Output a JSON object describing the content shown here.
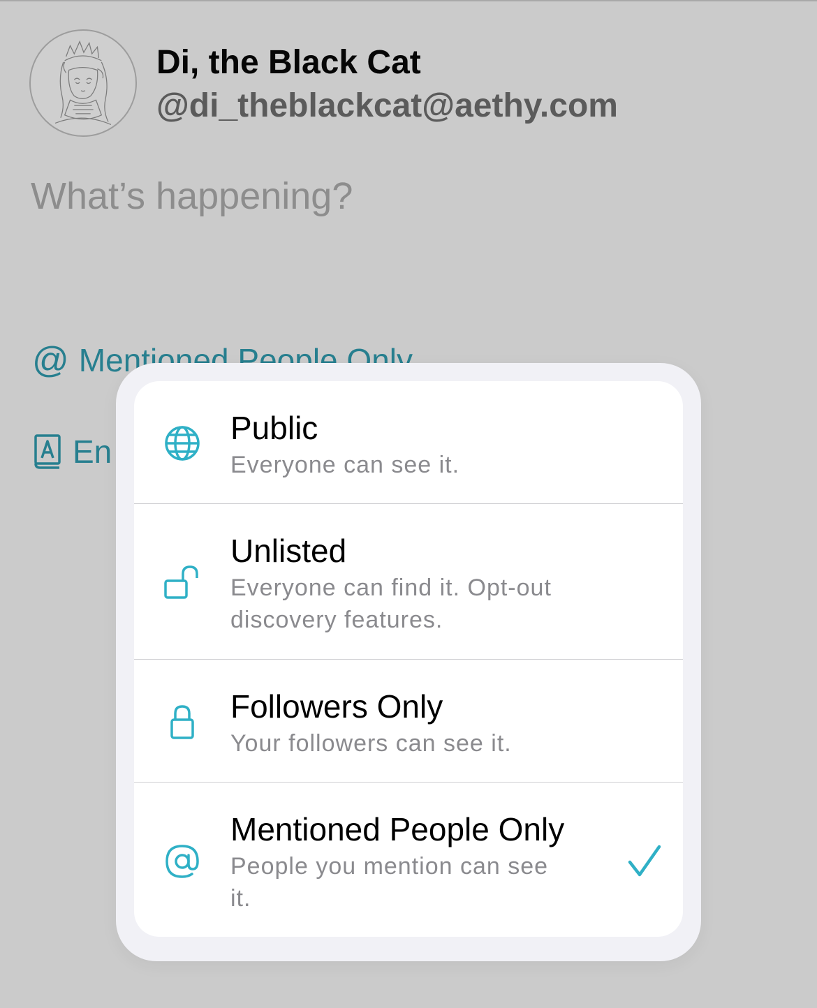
{
  "profile": {
    "display_name": "Di, the Black Cat",
    "handle": "@di_theblackcat@aethy.com"
  },
  "composer": {
    "placeholder": "What’s happening?"
  },
  "composer_options": {
    "visibility_label": "Mentioned People Only",
    "language_label": "En"
  },
  "visibility_menu": {
    "selected": "Mentioned People Only",
    "items": [
      {
        "icon": "globe-icon",
        "title": "Public",
        "description": "Everyone can see it."
      },
      {
        "icon": "unlocked-icon",
        "title": "Unlisted",
        "description": "Everyone can find it. Opt-out discovery features."
      },
      {
        "icon": "lock-icon",
        "title": "Followers Only",
        "description": "Your followers can see it."
      },
      {
        "icon": "at-sign-icon",
        "title": "Mentioned People Only",
        "description": "People you mention can see it."
      }
    ]
  },
  "colors": {
    "accent": "#2fb0c6",
    "dimmed_accent": "#277f8f",
    "dim_background": "#cbcbcb",
    "popover_background": "#f1f1f6"
  }
}
